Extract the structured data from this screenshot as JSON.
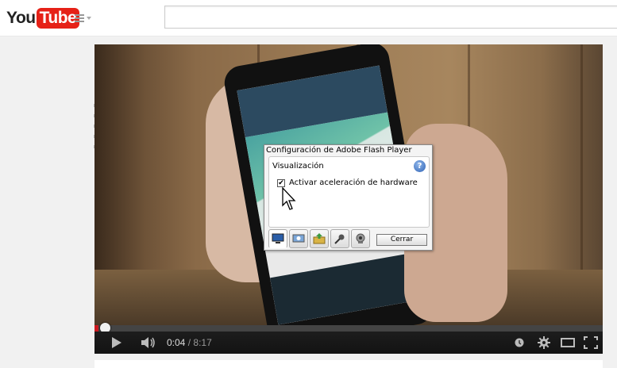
{
  "header": {
    "logo_you": "You",
    "logo_tube": "Tube",
    "guide_icon": "menu-icon",
    "search_placeholder": ""
  },
  "player": {
    "progress_fraction": 0.008,
    "current_time": "0:04",
    "separator": "/",
    "duration": "8:17",
    "controls_icons": [
      "play-icon",
      "volume-icon",
      "watch-later-icon",
      "settings-icon",
      "theater-mode-icon",
      "fullscreen-icon"
    ]
  },
  "flash_dialog": {
    "title": "Configuración de Adobe Flash Player",
    "section": "Visualización",
    "help_label": "?",
    "checkbox_label": "Activar aceleración de hardware",
    "checkbox_checked": true,
    "checkbox_mark": "✔",
    "tabs": [
      "display-icon",
      "privacy-icon",
      "storage-icon",
      "microphone-icon",
      "camera-icon"
    ],
    "close_label": "Cerrar"
  },
  "colors": {
    "youtube_red": "#e62117",
    "progress_red": "#cc181e"
  }
}
